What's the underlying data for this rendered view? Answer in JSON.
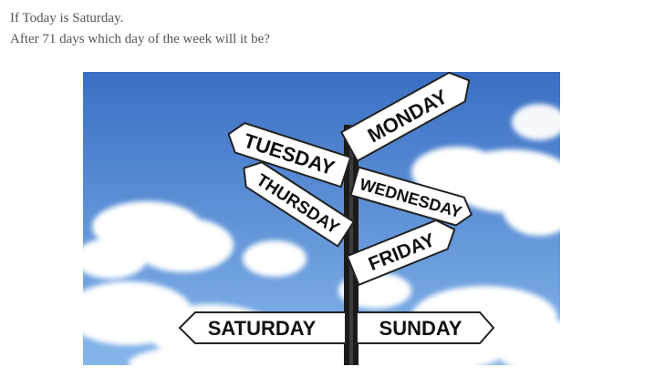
{
  "question": {
    "line1": "If Today is Saturday.",
    "line2": "After 71 days which day of the week will it be?"
  },
  "photo": {
    "signs": {
      "monday": "MONDAY",
      "tuesday": "TUESDAY",
      "wednesday": "WEDNESDAY",
      "thursday": "THURSDAY",
      "friday": "FRIDAY",
      "saturday": "SATURDAY",
      "sunday": "SUNDAY"
    },
    "colors": {
      "sky_top": "#3a6fc4",
      "sky_bottom": "#7fb0e6",
      "sign": "#ffffff",
      "post": "#1a1a1a"
    }
  }
}
